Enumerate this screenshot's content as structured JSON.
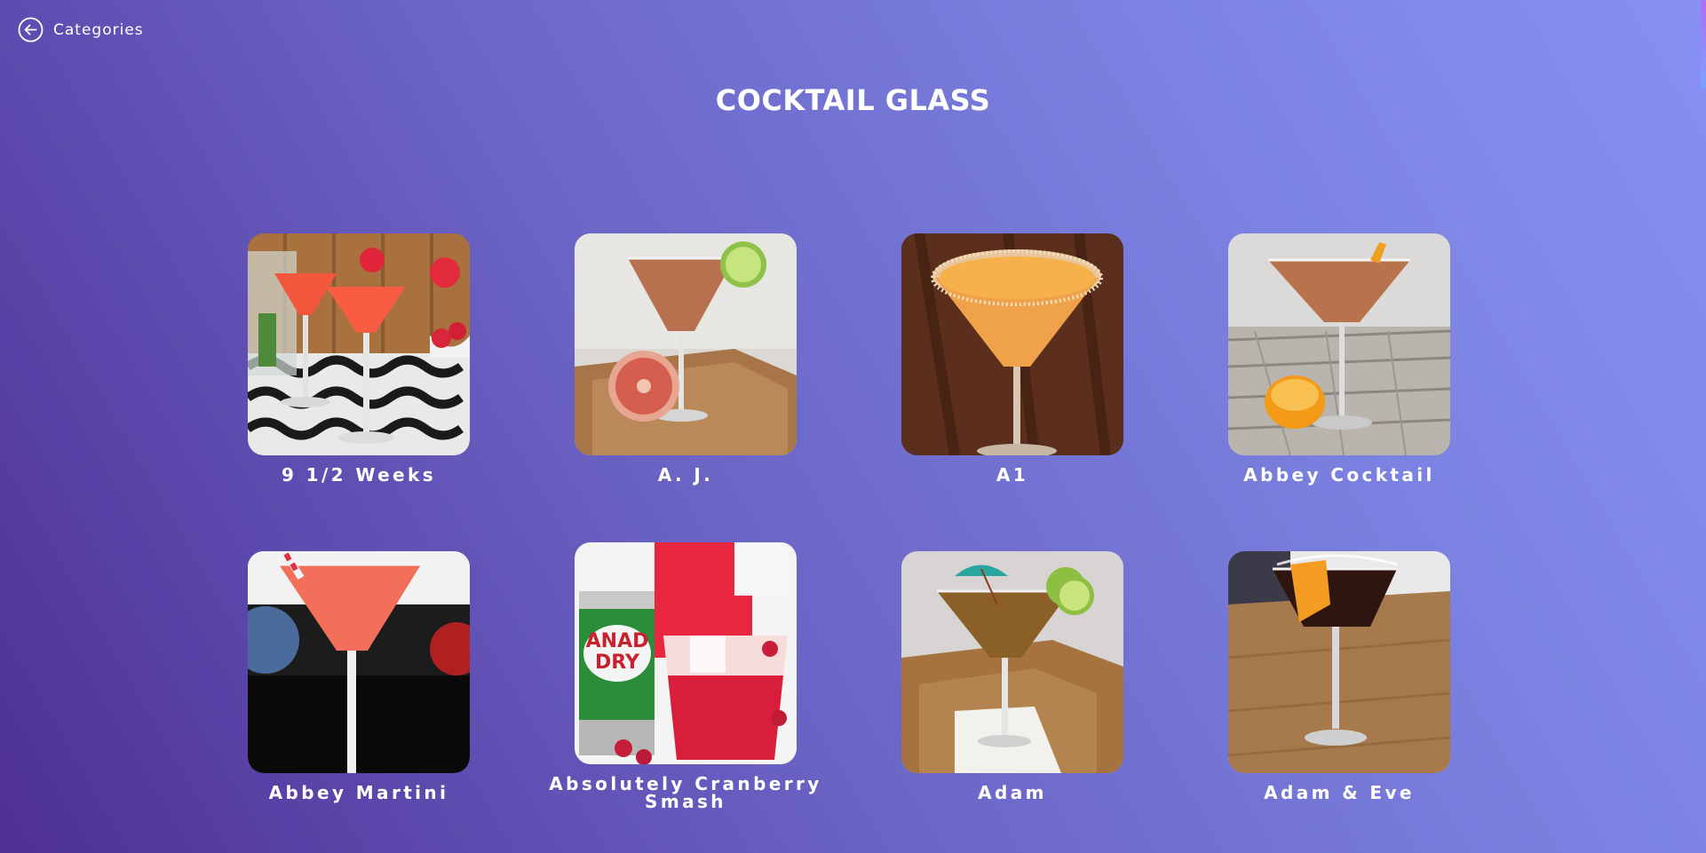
{
  "nav": {
    "back_label": "Categories",
    "back_icon": "arrow-left-circle-icon"
  },
  "page": {
    "title": "COCKTAIL GLASS"
  },
  "drinks": [
    {
      "name": "9 1/2 Weeks",
      "image": "pink cocktails with strawberries and cucumber on damask cloth"
    },
    {
      "name": "A. J.",
      "image": "cocktail with lime wheel and grapefruit on tray"
    },
    {
      "name": "A1",
      "image": "orange sugar-rimmed cocktail on dark wood"
    },
    {
      "name": "Abbey Cocktail",
      "image": "cocktail with orange peel and orange half on wood planks"
    },
    {
      "name": "Abbey Martini",
      "image": "pink martini with striped straw on dark background"
    },
    {
      "name": "Absolutely Cranberry Smash",
      "image": "ginger ale can and cranberry drink"
    },
    {
      "name": "Adam",
      "image": "cocktail with umbrella and lime wheels on wooden table"
    },
    {
      "name": "Adam & Eve",
      "image": "dark cocktail with orange peel on wood"
    }
  ]
}
